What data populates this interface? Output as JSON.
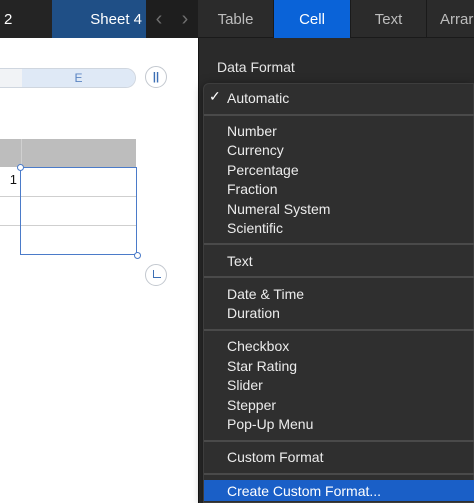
{
  "sheet_tabs": {
    "previous": "2",
    "active": "Sheet 4",
    "prev_arrow": "‹",
    "next_arrow": "›"
  },
  "inspector_tabs": [
    {
      "label": "Table",
      "active": false
    },
    {
      "label": "Cell",
      "active": true
    },
    {
      "label": "Text",
      "active": false
    },
    {
      "label": "Arrar",
      "active": false
    }
  ],
  "spreadsheet": {
    "column_header": "E",
    "cell_value": "1"
  },
  "inspector": {
    "section_label": "Data Format"
  },
  "menu": {
    "checkmark": "✓",
    "groups": [
      [
        "Automatic"
      ],
      [
        "Number",
        "Currency",
        "Percentage",
        "Fraction",
        "Numeral System",
        "Scientific"
      ],
      [
        "Text"
      ],
      [
        "Date & Time",
        "Duration"
      ],
      [
        "Checkbox",
        "Star Rating",
        "Slider",
        "Stepper",
        "Pop-Up Menu"
      ],
      [
        "Custom Format"
      ],
      [
        "Create Custom Format..."
      ]
    ],
    "selected": "Automatic",
    "highlighted": "Create Custom Format..."
  },
  "colors": {
    "accent": "#0a63d8",
    "menu_highlight": "#1a5fc7",
    "active_sheet_tab": "#1f4f86"
  }
}
